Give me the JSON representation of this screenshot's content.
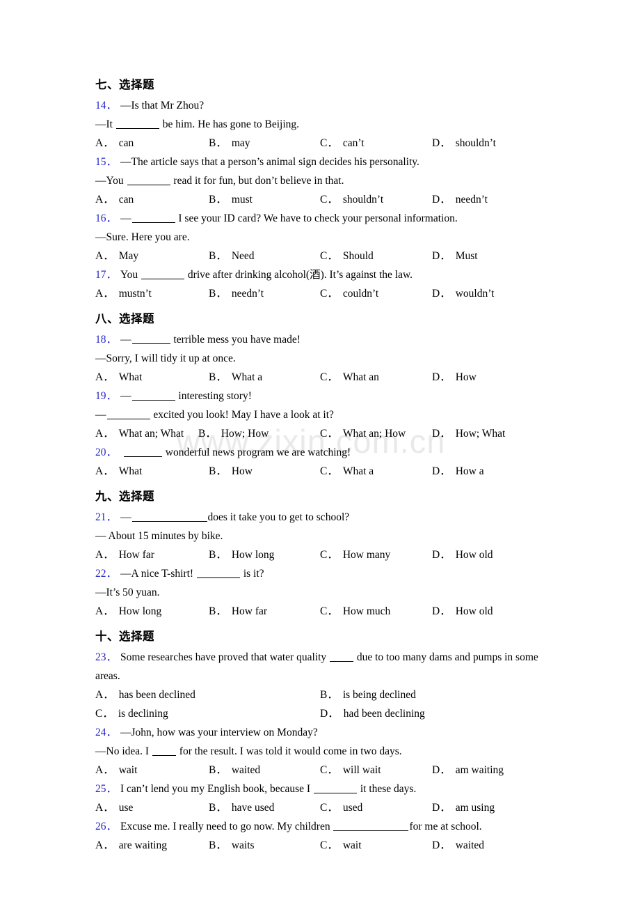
{
  "watermark": {
    "text": "www.zixin.com.cn",
    "color": "#e9e9e9"
  },
  "accent": {
    "question_number_color": "#2626cc"
  },
  "sections": [
    {
      "heading": "七、选择题",
      "questions": [
        {
          "number": "14．",
          "lines": [
            {
              "pre": "—Is that Mr Zhou?",
              "blank": "",
              "post": ""
            },
            {
              "pre": "—It ",
              "blank": "w-md",
              "post": " be him. He has gone to Beijing."
            }
          ],
          "layout": "g4",
          "options": [
            {
              "label": "A．",
              "text": "can"
            },
            {
              "label": "B．",
              "text": "may"
            },
            {
              "label": "C．",
              "text": "can’t"
            },
            {
              "label": "D．",
              "text": "shouldn’t"
            }
          ]
        },
        {
          "number": "15．",
          "lines": [
            {
              "pre": "—The article says that a person’s animal sign decides his personality.",
              "blank": "",
              "post": ""
            },
            {
              "pre": "—You ",
              "blank": "w-md",
              "post": " read it for fun, but don’t believe in that."
            }
          ],
          "layout": "g4",
          "options": [
            {
              "label": "A．",
              "text": "can"
            },
            {
              "label": "B．",
              "text": "must"
            },
            {
              "label": "C．",
              "text": "shouldn’t"
            },
            {
              "label": "D．",
              "text": "needn’t"
            }
          ]
        },
        {
          "number": "16．",
          "lines": [
            {
              "pre": "—",
              "blank": "w-md",
              "post": " I see your ID card? We have to check your personal information."
            },
            {
              "pre": "—Sure. Here you are.",
              "blank": "",
              "post": ""
            }
          ],
          "layout": "g4",
          "options": [
            {
              "label": "A．",
              "text": "May"
            },
            {
              "label": "B．",
              "text": "Need"
            },
            {
              "label": "C．",
              "text": "Should"
            },
            {
              "label": "D．",
              "text": "Must"
            }
          ]
        },
        {
          "number": "17．",
          "lines": [
            {
              "pre": "You ",
              "blank": "w-md",
              "post": " drive after drinking alcohol(酒). It’s against the law."
            }
          ],
          "layout": "g4",
          "options": [
            {
              "label": "A．",
              "text": "mustn’t"
            },
            {
              "label": "B．",
              "text": "needn’t"
            },
            {
              "label": "C．",
              "text": "couldn’t"
            },
            {
              "label": "D．",
              "text": "wouldn’t"
            }
          ]
        }
      ]
    },
    {
      "heading": "八、选择题",
      "questions": [
        {
          "number": "18．",
          "lines": [
            {
              "pre": "—",
              "blank": "w-sm",
              "post": " terrible mess you have made!"
            },
            {
              "pre": "—Sorry, I will tidy it up at once.",
              "blank": "",
              "post": ""
            }
          ],
          "layout": "g4",
          "options": [
            {
              "label": "A．",
              "text": "What"
            },
            {
              "label": "B．",
              "text": "What a"
            },
            {
              "label": "C．",
              "text": "What an"
            },
            {
              "label": "D．",
              "text": "How"
            }
          ]
        },
        {
          "number": "19．",
          "lines": [
            {
              "pre": "—",
              "blank": "w-md",
              "post": " interesting story!"
            },
            {
              "pre": "—",
              "blank": "w-md",
              "post": " excited you look! May I have a look at it?"
            }
          ],
          "layout": "g4w",
          "options": [
            {
              "label": "A．",
              "text": "What an; What"
            },
            {
              "label": "B．",
              "text": "How; How"
            },
            {
              "label": "C．",
              "text": "What an; How"
            },
            {
              "label": "D．",
              "text": "How; What"
            }
          ]
        },
        {
          "number": "20．",
          "lines": [
            {
              "pre": " ",
              "blank": "w-sm",
              "post": " wonderful news program we are watching!"
            }
          ],
          "layout": "g4",
          "options": [
            {
              "label": "A．",
              "text": "What"
            },
            {
              "label": "B．",
              "text": "How"
            },
            {
              "label": "C．",
              "text": "What a"
            },
            {
              "label": "D．",
              "text": "How a"
            }
          ]
        }
      ]
    },
    {
      "heading": "九、选择题",
      "questions": [
        {
          "number": "21．",
          "lines": [
            {
              "pre": "—",
              "blank": "w-xl",
              "post": "does it take you to get to school?"
            },
            {
              "pre": "— About 15 minutes by bike.",
              "blank": "",
              "post": ""
            }
          ],
          "layout": "g4",
          "options": [
            {
              "label": "A．",
              "text": "How far"
            },
            {
              "label": "B．",
              "text": "How long"
            },
            {
              "label": "C．",
              "text": "How many"
            },
            {
              "label": "D．",
              "text": "How old"
            }
          ]
        },
        {
          "number": "22．",
          "lines": [
            {
              "pre": "—A nice T-shirt! ",
              "blank": "w-md",
              "post": " is it?"
            },
            {
              "pre": "—It’s 50 yuan.",
              "blank": "",
              "post": ""
            }
          ],
          "layout": "g4",
          "options": [
            {
              "label": "A．",
              "text": "How long"
            },
            {
              "label": "B．",
              "text": "How far"
            },
            {
              "label": "C．",
              "text": "How much"
            },
            {
              "label": "D．",
              "text": "How old"
            }
          ]
        }
      ]
    },
    {
      "heading": "十、选择题",
      "questions": [
        {
          "number": "23．",
          "wrap": true,
          "lines": [
            {
              "pre": "Some researches have proved that water quality ",
              "blank": "w-xs",
              "post": " due to too many dams and pumps in some areas."
            }
          ],
          "layout": "g2",
          "options": [
            {
              "label": "A．",
              "text": "has been declined"
            },
            {
              "label": "B．",
              "text": "is being declined"
            },
            {
              "label": "C．",
              "text": "is declining"
            },
            {
              "label": "D．",
              "text": "had been declining"
            }
          ]
        },
        {
          "number": "24．",
          "lines": [
            {
              "pre": "—John, how was your interview on Monday?",
              "blank": "",
              "post": ""
            },
            {
              "pre": "—No idea. I ",
              "blank": "w-xs",
              "post": " for the result. I was told it would come in two days."
            }
          ],
          "layout": "g4",
          "options": [
            {
              "label": "A．",
              "text": "wait"
            },
            {
              "label": "B．",
              "text": "waited"
            },
            {
              "label": "C．",
              "text": "will wait"
            },
            {
              "label": "D．",
              "text": "am waiting"
            }
          ]
        },
        {
          "number": "25．",
          "lines": [
            {
              "pre": "I can’t lend you my English book, because I ",
              "blank": "w-md",
              "post": " it these days."
            }
          ],
          "layout": "g4",
          "options": [
            {
              "label": "A．",
              "text": "use"
            },
            {
              "label": "B．",
              "text": "have used"
            },
            {
              "label": "C．",
              "text": "used"
            },
            {
              "label": "D．",
              "text": "am using"
            }
          ]
        },
        {
          "number": "26．",
          "lines": [
            {
              "pre": "Excuse me. I really need to go now. My children ",
              "blank": "w-xl",
              "post": "for me at school."
            }
          ],
          "layout": "g4",
          "options": [
            {
              "label": "A．",
              "text": "are waiting"
            },
            {
              "label": "B．",
              "text": "waits"
            },
            {
              "label": "C．",
              "text": "wait"
            },
            {
              "label": "D．",
              "text": "waited"
            }
          ]
        }
      ]
    }
  ]
}
